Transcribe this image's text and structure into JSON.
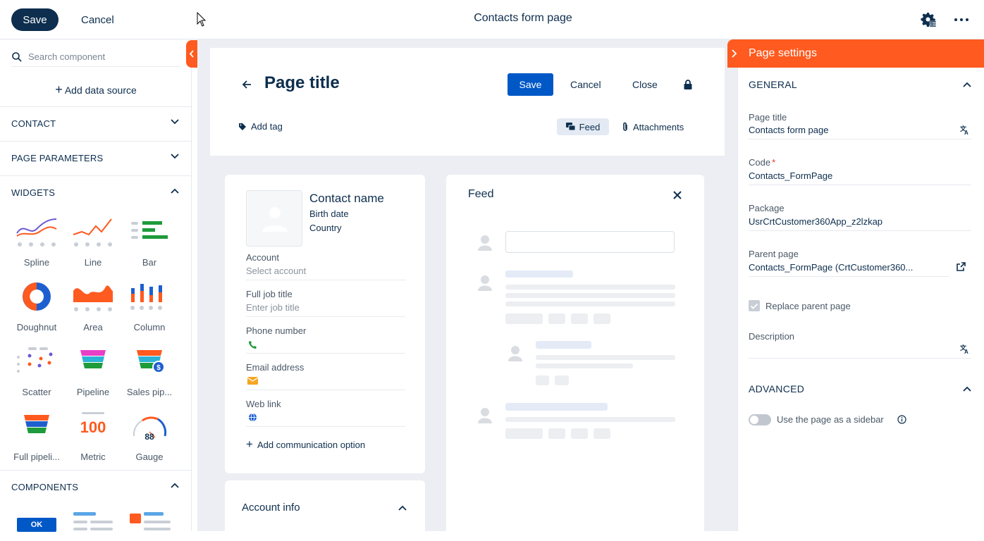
{
  "topbar": {
    "save_label": "Save",
    "cancel_label": "Cancel",
    "page_heading": "Contacts form page"
  },
  "left_panel": {
    "search_placeholder": "Search component",
    "add_data_source": "Add data source",
    "sections": {
      "contact": "CONTACT",
      "page_parameters": "PAGE PARAMETERS",
      "widgets": "WIDGETS",
      "components": "COMPONENTS"
    },
    "widgets": [
      {
        "label": "Spline",
        "icon": "spline-icon"
      },
      {
        "label": "Line",
        "icon": "line-chart-icon"
      },
      {
        "label": "Bar",
        "icon": "bar-chart-icon"
      },
      {
        "label": "Doughnut",
        "icon": "doughnut-icon"
      },
      {
        "label": "Area",
        "icon": "area-chart-icon"
      },
      {
        "label": "Column",
        "icon": "column-chart-icon"
      },
      {
        "label": "Scatter",
        "icon": "scatter-icon"
      },
      {
        "label": "Pipeline",
        "icon": "pipeline-icon"
      },
      {
        "label": "Sales pip...",
        "icon": "sales-pipeline-icon"
      },
      {
        "label": "Full pipeli...",
        "icon": "full-pipeline-icon"
      },
      {
        "label": "Metric",
        "icon": "metric-icon",
        "value": "100"
      },
      {
        "label": "Gauge",
        "icon": "gauge-icon",
        "value": "88"
      }
    ],
    "components_ok": "OK"
  },
  "form": {
    "page_title": "Page title",
    "save_label": "Save",
    "cancel_label": "Cancel",
    "close_label": "Close",
    "add_tag": "Add tag",
    "feed_tab": "Feed",
    "attachments_tab": "Attachments",
    "contact": {
      "name": "Contact name",
      "birth_date": "Birth date",
      "country": "Country"
    },
    "fields": [
      {
        "label": "Account",
        "value": "Select account"
      },
      {
        "label": "Full job title",
        "value": "Enter job title"
      },
      {
        "label": "Phone number",
        "icon": "phone-icon"
      },
      {
        "label": "Email address",
        "icon": "email-icon"
      },
      {
        "label": "Web link",
        "icon": "globe-icon"
      }
    ],
    "add_communication": "Add communication option",
    "account_info": "Account info",
    "feed_title": "Feed"
  },
  "settings": {
    "header": "Page settings",
    "general": "GENERAL",
    "page_title_label": "Page title",
    "page_title_value": "Contacts form page",
    "code_label": "Code",
    "code_required": "*",
    "code_value": "Contacts_FormPage",
    "package_label": "Package",
    "package_value": "UsrCrtCustomer360App_z2lzkap",
    "parent_label": "Parent page",
    "parent_value": "Contacts_FormPage (CrtCustomer360...",
    "replace_parent": "Replace parent page",
    "replace_parent_checked": true,
    "description_label": "Description",
    "advanced": "ADVANCED",
    "sidebar_toggle": "Use the page as a sidebar",
    "sidebar_toggle_on": false
  },
  "colors": {
    "accent": "#ff5a1f",
    "primary": "#0058c7",
    "dark": "#0d2e4e"
  }
}
